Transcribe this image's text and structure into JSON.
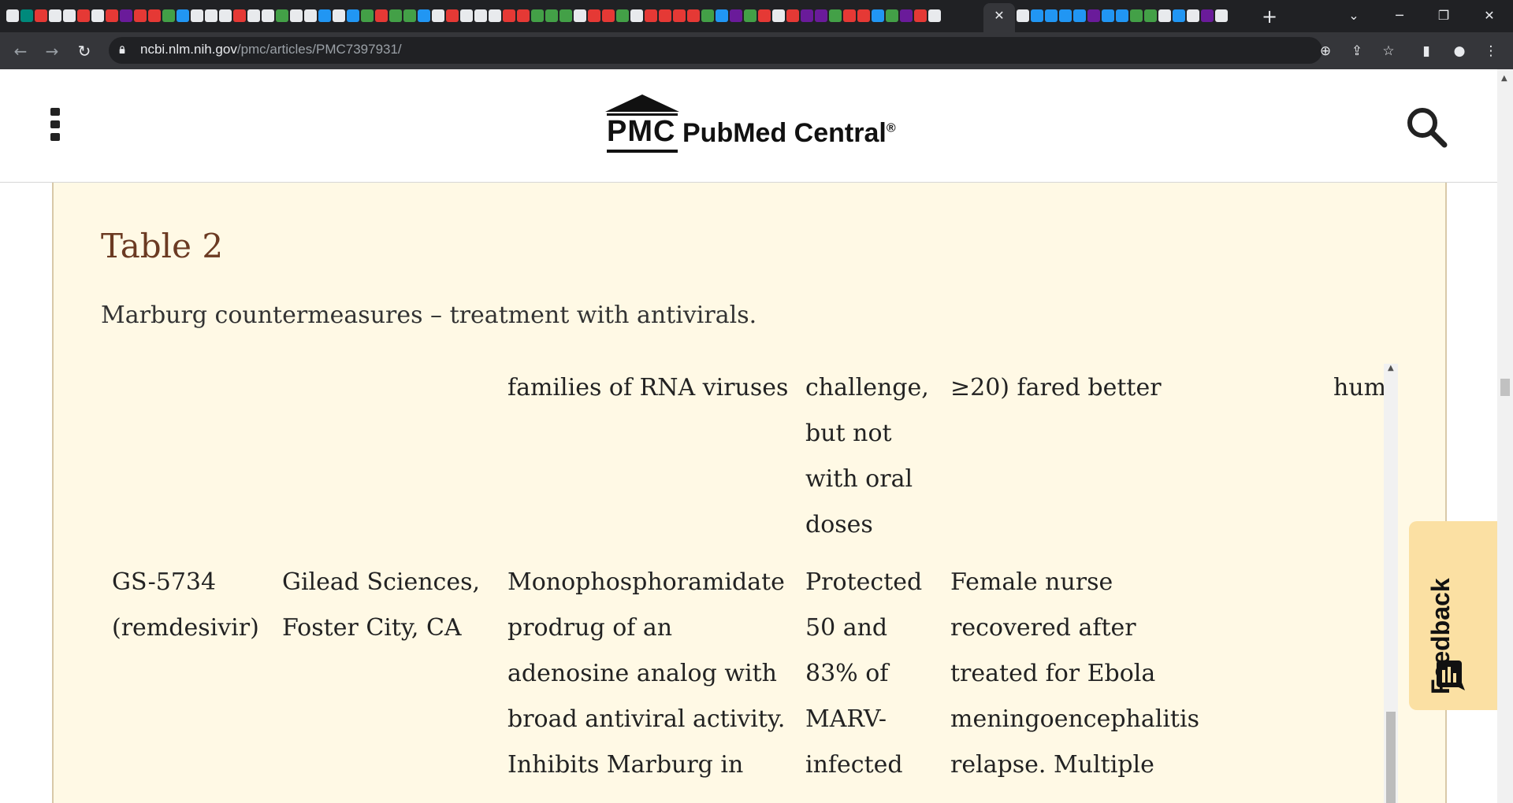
{
  "browser": {
    "active_tab_close": "✕",
    "new_tab": "+",
    "tab_favicon_colors": [
      "#e8eaed",
      "#00897b",
      "#e53935",
      "#e8eaed",
      "#e8eaed",
      "#e53935",
      "#e8eaed",
      "#e53935",
      "#6a1b9a",
      "#e53935",
      "#e53935",
      "#43a047",
      "#2196f3",
      "#e8eaed",
      "#e8eaed",
      "#e8eaed",
      "#e53935",
      "#e8eaed",
      "#e8eaed",
      "#43a047",
      "#e8eaed",
      "#e8eaed",
      "#2196f3",
      "#e8eaed",
      "#2196f3",
      "#43a047",
      "#e53935",
      "#43a047",
      "#43a047",
      "#2196f3",
      "#e8eaed",
      "#e53935",
      "#e8eaed",
      "#e8eaed",
      "#e8eaed",
      "#e53935",
      "#e53935",
      "#43a047",
      "#43a047",
      "#43a047",
      "#e8eaed",
      "#e53935",
      "#e53935",
      "#43a047",
      "#e8eaed",
      "#e53935",
      "#e53935",
      "#e53935",
      "#e53935",
      "#43a047",
      "#2196f3",
      "#6a1b9a",
      "#43a047",
      "#e53935",
      "#e8eaed",
      "#e53935",
      "#6a1b9a",
      "#6a1b9a",
      "#43a047",
      "#e53935",
      "#e53935",
      "#2196f3",
      "#43a047",
      "#6a1b9a",
      "#e53935",
      "#e8eaed"
    ],
    "tab_favicon_colors_right": [
      "#e8eaed",
      "#2196f3",
      "#2196f3",
      "#2196f3",
      "#2196f3",
      "#6a1b9a",
      "#2196f3",
      "#2196f3",
      "#43a047",
      "#43a047",
      "#e8eaed",
      "#2196f3",
      "#e8eaed",
      "#6a1b9a",
      "#e8eaed"
    ],
    "url_domain": "ncbi.nlm.nih.gov",
    "url_path": "/pmc/articles/PMC7397931/",
    "icons": [
      "back-icon",
      "forward-icon",
      "reload-icon",
      "lock-icon",
      "zoom-icon",
      "share-icon",
      "star-icon",
      "side-panel-icon",
      "profile-icon",
      "more-icon"
    ]
  },
  "header": {
    "logo_abbr": "PMC",
    "logo_name": "PubMed Central",
    "logo_reg": "®"
  },
  "table": {
    "title": "Table 2",
    "caption": "Marburg countermeasures – treatment with antivirals.",
    "partial_row": {
      "mechanism": "families of RNA viruses",
      "animal_1": "challenge,",
      "animal_2": "but not",
      "animal_3": "with oral",
      "animal_4": "doses",
      "human": "≥20) fared better",
      "extra": "hum"
    },
    "row": {
      "drug_1": "GS-5734",
      "drug_2": "(remdesivir)",
      "company_1": "Gilead Sciences,",
      "company_2": "Foster City, CA",
      "mechanism_1": "Monophosphoramidate",
      "mechanism_2": "prodrug of an",
      "mechanism_3": "adenosine analog with",
      "mechanism_4": "broad antiviral activity.",
      "mechanism_5": "Inhibits Marburg in",
      "animal_1": "Protected",
      "animal_2": "50 and",
      "animal_3": "83% of",
      "animal_4": "MARV-",
      "animal_5": "infected",
      "human_1": "Female nurse",
      "human_2": "recovered after",
      "human_3": "treated for Ebola",
      "human_4": "meningoencephalitis",
      "human_5": "relapse. Multiple"
    }
  },
  "feedback": {
    "label": "Feedback",
    "bg_color": "#fbe0a3"
  },
  "colors": {
    "panel_bg": "#fff9e5",
    "title_color": "#6b3a22"
  }
}
